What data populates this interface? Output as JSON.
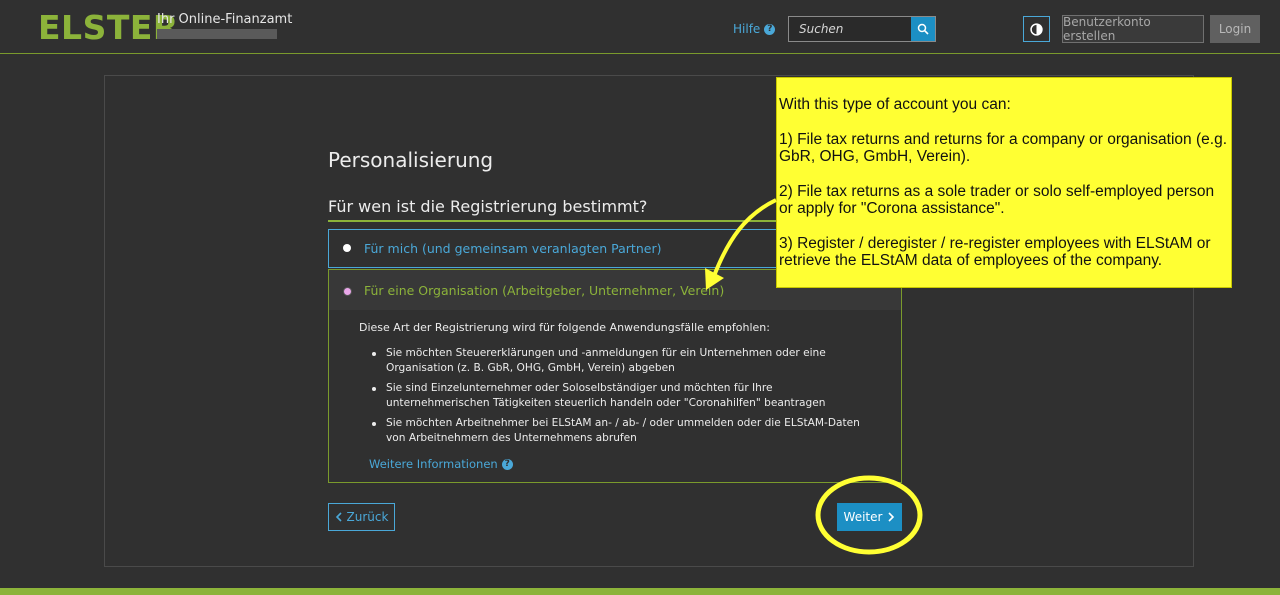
{
  "header": {
    "logo": "ELSTER",
    "logo_subtitle": "Ihr Online-Finanzamt",
    "help_label": "Hilfe",
    "search_placeholder": "Suchen",
    "create_account_label": "Benutzerkonto erstellen",
    "login_label": "Login"
  },
  "main": {
    "title": "Personalisierung",
    "question": "Für wen ist die Registrierung bestimmt?",
    "options": [
      {
        "label": "Für mich (und gemeinsam veranlagten Partner)",
        "selected": false
      },
      {
        "label": "Für eine Organisation (Arbeitgeber, Unternehmer, Verein)",
        "selected": true
      }
    ],
    "description_intro": "Diese Art der Registrierung wird für folgende Anwendungsfälle empfohlen:",
    "bullets": [
      "Sie möchten Steuererklärungen und -anmeldungen für ein Unternehmen oder eine Organisation (z. B. GbR, OHG, GmbH, Verein) abgeben",
      "Sie sind Einzelunternehmer oder Soloselbständiger und möchten für Ihre unternehmerischen Tätigkeiten steuerlich handeln oder \"Coronahilfen\" beantragen",
      "Sie möchten Arbeitnehmer bei ELStAM an- / ab- / oder ummelden oder die ELStAM-Daten von Arbeitnehmern des Unternehmens abrufen"
    ],
    "more_info_label": "Weitere Informationen",
    "back_label": "Zurück",
    "next_label": "Weiter"
  },
  "annotation": {
    "lines": [
      "With this type of account you can:",
      "1) File tax returns and returns for a company or organisation (e.g. GbR, OHG, GmbH, Verein).",
      "2) File tax returns as a sole trader or solo self-employed person or apply for \"Corona assistance\".",
      "3) Register / deregister / re-register employees with ELStAM or retrieve the ELStAM data of employees of the company."
    ]
  },
  "colors": {
    "accent_green": "#8cb33a",
    "accent_blue": "#4aa8d8",
    "button_blue": "#1c8fc4",
    "annotation_yellow": "#ffff33"
  }
}
